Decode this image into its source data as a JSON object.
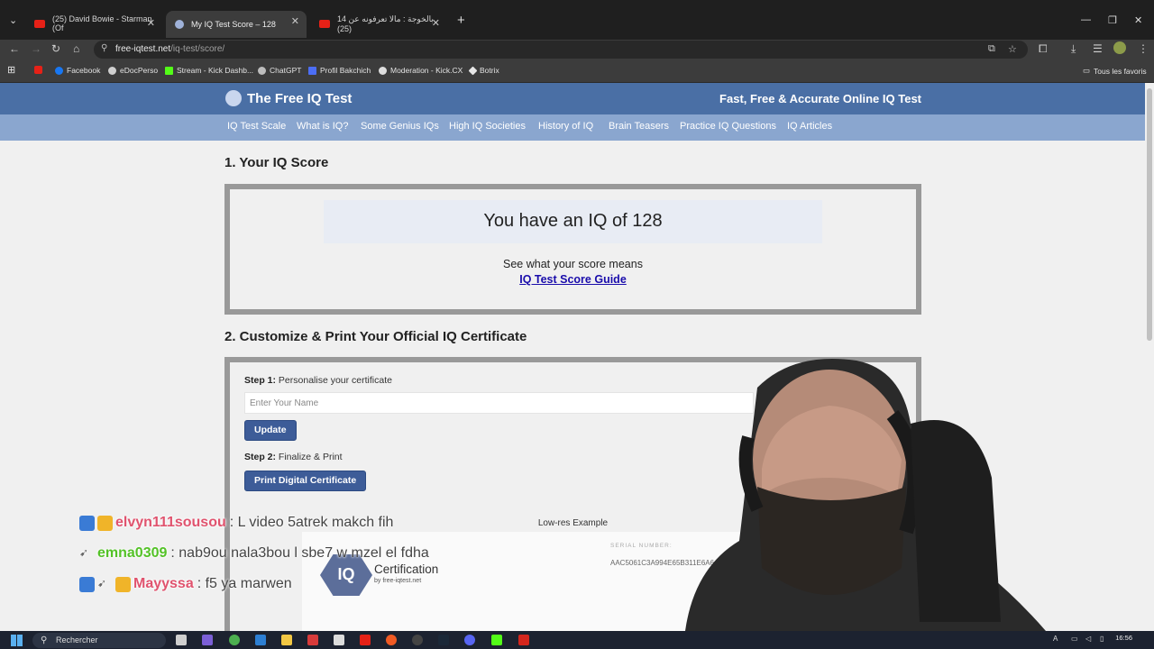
{
  "browser": {
    "tabs": [
      {
        "label": "(25) David Bowie - Starman (Of",
        "favicon": "youtube-icon",
        "active": false
      },
      {
        "label": "My IQ Test Score – 128",
        "favicon": "iq-site-icon",
        "active": true
      },
      {
        "label": "14 بالخوجة : مالا تعرفونه عن (25)",
        "favicon": "youtube-icon",
        "active": false
      }
    ],
    "new_tab": "+",
    "url_host": "free-iqtest.net",
    "url_path": "/iq-test/score/",
    "bookmarks": [
      {
        "label": "",
        "icon": "youtube-icon"
      },
      {
        "label": "Facebook",
        "icon": "facebook-icon"
      },
      {
        "label": "eDocPerso",
        "icon": "edocperso-icon"
      },
      {
        "label": "Stream - Kick Dashb...",
        "icon": "kick-icon"
      },
      {
        "label": "ChatGPT",
        "icon": "chatgpt-icon"
      },
      {
        "label": "Profil Bakchich",
        "icon": "bakchich-icon"
      },
      {
        "label": "Moderation - Kick.CX",
        "icon": "gear-icon"
      },
      {
        "label": "Botrix",
        "icon": "botrix-icon"
      }
    ],
    "all_bookmarks": "Tous les favoris"
  },
  "site": {
    "title": "The Free IQ Test",
    "tagline": "Fast, Free & Accurate Online IQ Test",
    "nav": [
      "IQ Test Scale",
      "What is IQ?",
      "Some Genius IQs",
      "High IQ Societies",
      "History of IQ",
      "Brain Teasers",
      "Practice IQ Questions",
      "IQ Articles"
    ]
  },
  "score_section": {
    "heading": "1. Your IQ Score",
    "score_text": "You have an IQ of 128",
    "meaning_text": "See what your score means",
    "guide_link": "IQ Test Score Guide"
  },
  "cert_section": {
    "heading": "2. Customize & Print Your Official IQ Certificate",
    "step1_bold": "Step 1:",
    "step1_text": " Personalise your certificate",
    "name_placeholder": "Enter Your Name",
    "update_button": "Update",
    "step2_bold": "Step 2:",
    "step2_text": " Finalize & Print",
    "print_button": "Print Digital Certificate",
    "lowres_label": "Low-res Example",
    "cert_seal": "IQ",
    "cert_title": "Certification",
    "cert_by": "by free-iqtest.net",
    "serial_label": "SERIAL NUMBER:",
    "serial_number": "AAC5061C3A994E65B311E6A6"
  },
  "chat": [
    {
      "user": "elvyn111sousou",
      "message": ": L video 5atrek makch fih",
      "color": "#e0536e"
    },
    {
      "user": "emna0309",
      "message": ": nab9ou nala3bou l sbe7 w mzel el fdha",
      "color": "#53c227"
    },
    {
      "user": "Mayyssa",
      "message": ": f5 ya marwen",
      "color": "#e0536e"
    }
  ],
  "taskbar": {
    "search_placeholder": "Rechercher",
    "lang": "A",
    "time": "16:56"
  }
}
